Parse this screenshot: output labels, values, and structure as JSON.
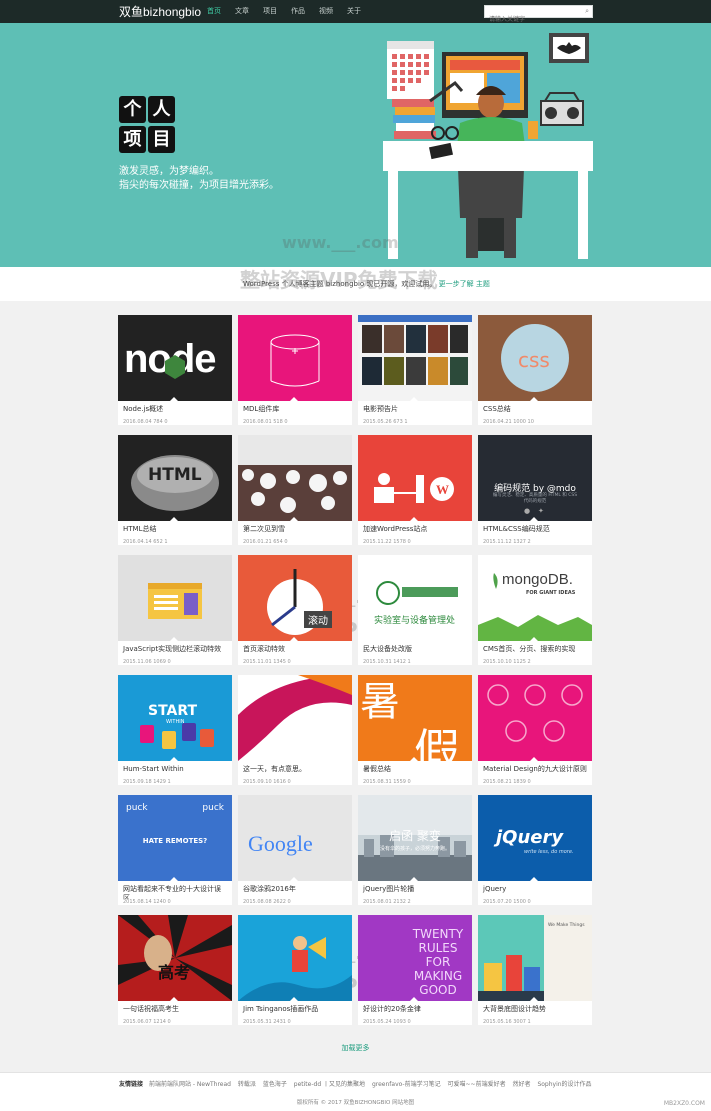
{
  "header": {
    "logo": "双鱼bizhongbio",
    "nav": [
      "首页",
      "文章",
      "项目",
      "作品",
      "视频",
      "关于"
    ],
    "search_placeholder": "请输入关键字"
  },
  "hero": {
    "title_chars": [
      "个",
      "人",
      "项",
      "目"
    ],
    "subtitle_1": "激发灵感，为梦编织。",
    "subtitle_2": "指尖的每次碰撞，为项目增光添彩。"
  },
  "strip": {
    "text": "WordPress 个人博客主题 bizhongbio 现已开源，欢迎试用。",
    "link": "更一步了解 主题"
  },
  "watermark": {
    "url": "www.___.com",
    "text": "整站资源VIP免费下载"
  },
  "cards": [
    {
      "title": "Node.js概述",
      "meta": "2016.08.04  784  0"
    },
    {
      "title": "MDL组件库",
      "meta": "2016.08.01  518  0"
    },
    {
      "title": "电影预告片",
      "meta": "2015.05.26  673  1"
    },
    {
      "title": "CSS总结",
      "meta": "2016.04.21  1000  10"
    },
    {
      "title": "HTML总结",
      "meta": "2016.04.14  652  1"
    },
    {
      "title": "第二次见到雪",
      "meta": "2016.01.21  654  0"
    },
    {
      "title": "加速WordPress站点",
      "meta": "2015.11.22  1578  0"
    },
    {
      "title": "HTML&CSS编码规范",
      "meta": "2015.11.12  1327  2"
    },
    {
      "title": "JavaScript实现侧边栏滚动特效",
      "meta": "2015.11.06  1069  0"
    },
    {
      "title": "首页滚动特效",
      "meta": "2015.11.01  1345  0"
    },
    {
      "title": "民大设备处改版",
      "meta": "2015.10.31  1412  1"
    },
    {
      "title": "CMS首页、分页、搜索的实现",
      "meta": "2015.10.10  1125  2"
    },
    {
      "title": "Hum-Start Within",
      "meta": "2015.09.18  1429  1"
    },
    {
      "title": "这一天，有点意思。",
      "meta": "2015.09.10  1616  0"
    },
    {
      "title": "暑假总结",
      "meta": "2015.08.31  1559  0"
    },
    {
      "title": "Material Design的九大设计原则",
      "meta": "2015.08.21  1839  0"
    },
    {
      "title": "网站看起来不专业的十大设计误区",
      "meta": "2015.08.14  1240  0"
    },
    {
      "title": "谷歌涂鸦2016年",
      "meta": "2015.08.08  2622  0"
    },
    {
      "title": "jQuery图片轮播",
      "meta": "2015.08.01  2132  2"
    },
    {
      "title": "jQuery",
      "meta": "2015.07.20  1500  0"
    },
    {
      "title": "一句话祝福高考生",
      "meta": "2015.06.07  1214  0"
    },
    {
      "title": "Jim Tsinganos插画作品",
      "meta": "2015.05.31  2431  0"
    },
    {
      "title": "好设计的20条金律",
      "meta": "2015.05.24  1093  0"
    },
    {
      "title": "大背景底图设计趋势",
      "meta": "2015.05.16  3007  1"
    }
  ],
  "thumb_text": {
    "node": "node",
    "html": "HTML",
    "spec_title": "编码规范 by @mdo",
    "spec_sub": "编写灵活、稳定、高质量的 HTML 和 CSS 代码的规范",
    "scroll": "滚动",
    "mongo": "mongoDB.",
    "mongo_sub": "FOR GIANT IDEAS",
    "lab": "实验室与设备管理处",
    "start": "START",
    "start_sub": "WITHIN",
    "summer_1": "暑",
    "summer_2": "假",
    "puck_left": "puck",
    "puck_right": "puck",
    "remote": "HATE REMOTES?",
    "google": "Google",
    "slogan": "启函 聚变",
    "slogan_sub": "没有伞的孩子，必须努力奔跑。",
    "jquery": "jQuery",
    "jquery_sub": "write less, do more.",
    "gaokao": "高考",
    "rules": "TWENTY RULES FOR MAKING GOOD",
    "trend": "We Make Things"
  },
  "load_more": "加载更多",
  "footer": {
    "links_label": "友情链接",
    "links": [
      "前端前端队网站 - NewThread",
      "转载派",
      "蓝色海子",
      "petite-dd 丨又见的集聚地",
      "greenfavo-前端学习笔记",
      "可爱喵~~前端爱好者",
      "然好者",
      "Sophyin的设计作品"
    ],
    "copyright": "版权所有 © 2017 双鱼BIZHONGBIO 网站地图",
    "corner": "MB2XZ0.COM"
  },
  "colors": {
    "topbar": "#1d2a28",
    "hero": "#5ebfb5",
    "accent": "#3fd0a8",
    "link": "#1c9c7e"
  }
}
